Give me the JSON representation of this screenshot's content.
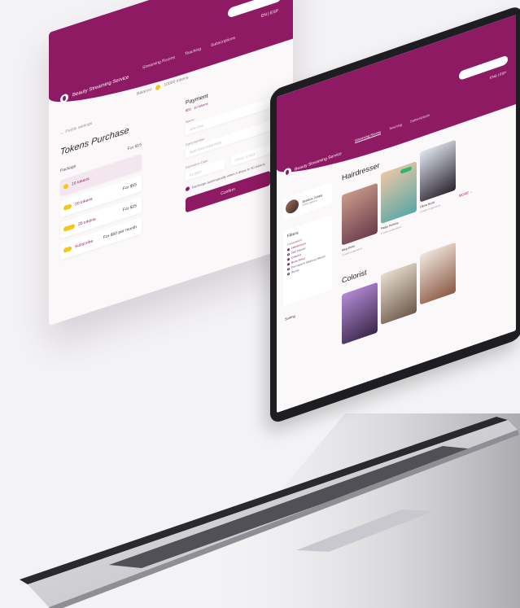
{
  "app": {
    "brand": "Beauty Streaming Service"
  },
  "panel": {
    "nav": [
      "Streaming Rooms",
      "Teaching",
      "Subscriptions"
    ],
    "lang": "EN | ESP",
    "balance_label": "Balance:",
    "balance_value": "10000 tokens",
    "back": "← Profile settings",
    "title": "Tokens Purchase",
    "package_header": "Package",
    "packages": [
      {
        "name": "10 tokens",
        "price": "For $15"
      },
      {
        "name": "20 tokens",
        "price": "For $55"
      },
      {
        "name": "20 tokens",
        "price": "For $25"
      },
      {
        "name": "Subscribe",
        "price": "For $50 per month"
      }
    ],
    "payment": {
      "title": "Payment",
      "subtitle": "$55 · 10 tokens",
      "name_label": "Name",
      "name_placeholder": "John Doe",
      "card_label": "Card number",
      "card_placeholder": "0000 0000 0000 0000",
      "expiry_label": "Expiration Date",
      "month": "01",
      "year": "2025",
      "cvv_placeholder": "CVV2 / CVC2",
      "recharge": "Recharge automatically when it drops to 50 tokens",
      "confirm": "Confirm"
    }
  },
  "screen": {
    "nav": [
      "Streaming Rooms",
      "Teaching",
      "Subscriptions"
    ],
    "lang": "ENG | ESP",
    "profile": {
      "name": "Jessica Jones",
      "tokens": "1000 tokens"
    },
    "filters": {
      "title": "Filters",
      "group": "Occupation",
      "options": [
        {
          "label": "Hairdresser",
          "on": true
        },
        {
          "label": "Nail Master",
          "on": false
        },
        {
          "label": "Colorist",
          "on": true
        },
        {
          "label": "Brow Artist",
          "on": true
        },
        {
          "label": "Permanent Makeup Master",
          "on": false
        },
        {
          "label": "Stylist",
          "on": false
        }
      ]
    },
    "sorting": "Sorting",
    "sections": [
      {
        "title": "Hairdresser",
        "cards": [
          {
            "name": "Meg Duke",
            "exp": "3 years experience"
          },
          {
            "name": "Paige Perkins",
            "exp": "2 years experience"
          },
          {
            "name": "Olivia Scott",
            "exp": "2 years experience"
          }
        ],
        "more": "MORE →"
      },
      {
        "title": "Colorist",
        "cards": []
      }
    ]
  },
  "colors": {
    "brand": "#8e1a63",
    "coin": "#f5c518",
    "background": "#f3f2f4"
  }
}
